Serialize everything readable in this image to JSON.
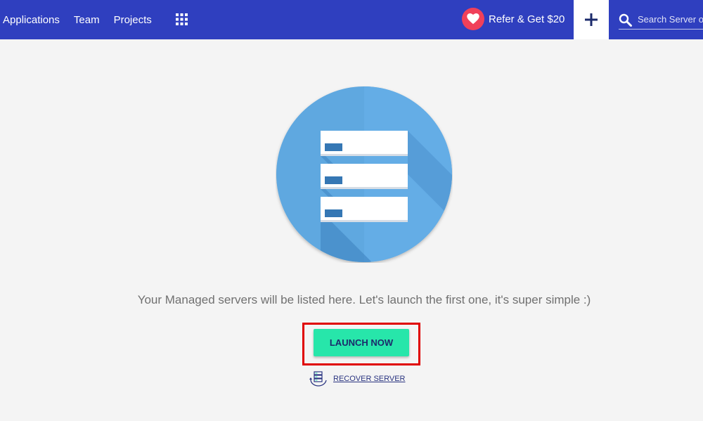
{
  "nav": {
    "items": [
      {
        "label": "Applications"
      },
      {
        "label": "Team"
      },
      {
        "label": "Projects"
      }
    ]
  },
  "refer": {
    "label": "Refer & Get $20"
  },
  "search": {
    "placeholder": "Search Server or"
  },
  "empty_state": {
    "message": "Your Managed servers will be listed here. Let's launch the first one, it's super simple :)",
    "launch_label": "LAUNCH NOW",
    "recover_label": "RECOVER SERVER"
  },
  "colors": {
    "topbar": "#2f3fbf",
    "accent": "#27e6aa",
    "heart": "#f0405a",
    "highlight": "#e00000",
    "illustration": "#5fa8e0"
  },
  "icons": {
    "apps": "grid-icon",
    "refer": "heart-icon",
    "add": "plus-icon",
    "search": "search-icon",
    "recover": "server-recover-icon"
  }
}
